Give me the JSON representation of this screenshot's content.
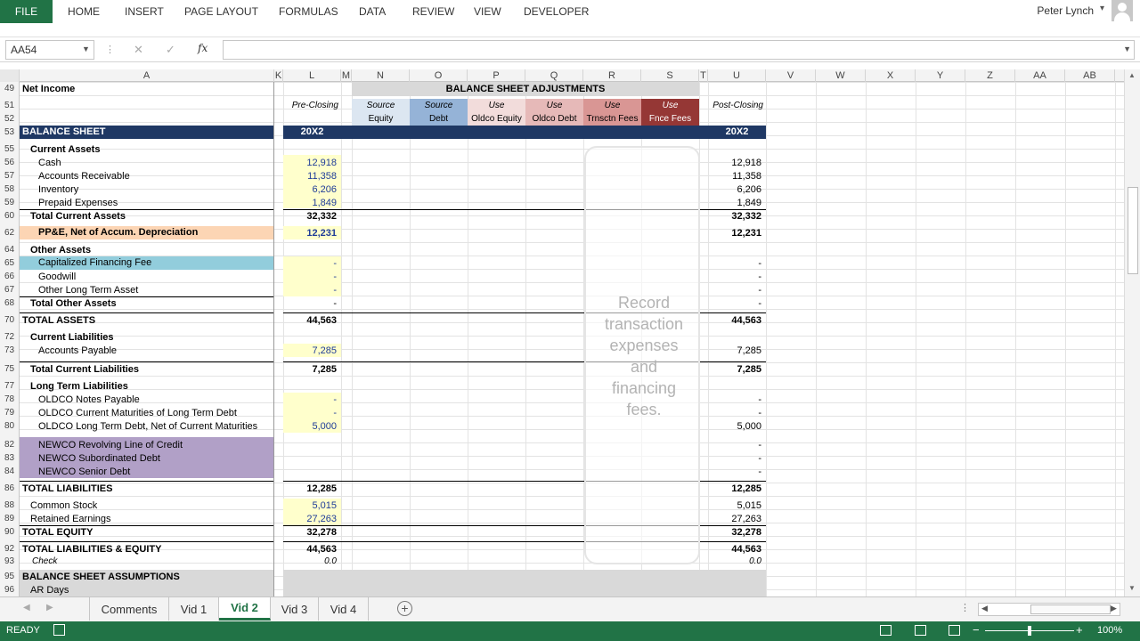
{
  "ribbon": {
    "file": "FILE",
    "tabs": [
      "HOME",
      "INSERT",
      "PAGE LAYOUT",
      "FORMULAS",
      "DATA",
      "REVIEW",
      "VIEW",
      "DEVELOPER"
    ],
    "user": "Peter Lynch"
  },
  "formula_bar": {
    "name_box": "AA54",
    "cancel": "✕",
    "enter": "✓",
    "fx": "fx",
    "formula": ""
  },
  "columns": [
    "A",
    "K",
    "L",
    "M",
    "N",
    "O",
    "P",
    "Q",
    "R",
    "S",
    "T",
    "U",
    "V",
    "W",
    "X",
    "Y",
    "Z",
    "AA",
    "AB"
  ],
  "rows": [
    "49",
    "51",
    "52",
    "53",
    "55",
    "56",
    "57",
    "58",
    "59",
    "60",
    "62",
    "64",
    "65",
    "66",
    "67",
    "68",
    "70",
    "72",
    "73",
    "75",
    "77",
    "78",
    "79",
    "80",
    "82",
    "83",
    "84",
    "86",
    "88",
    "89",
    "90",
    "92",
    "93",
    "95",
    "96"
  ],
  "labels": {
    "net_income": "Net Income",
    "balance_sheet": "BALANCE SHEET",
    "current_assets": "Current Assets",
    "cash": "Cash",
    "ar": "Accounts Receivable",
    "inventory": "Inventory",
    "prepaid": "Prepaid Expenses",
    "total_current_assets": "Total Current Assets",
    "ppe": "PP&E, Net of Accum. Depreciation",
    "other_assets": "Other Assets",
    "cap_fin_fee": "Capitalized Financing Fee",
    "goodwill": "Goodwill",
    "other_lt_asset": "Other Long Term Asset",
    "total_other_assets": "Total Other Assets",
    "total_assets": "TOTAL ASSETS",
    "current_liabilities": "Current Liabilities",
    "ap": "Accounts Payable",
    "total_current_liabilities": "Total Current Liabilities",
    "lt_liabilities": "Long Term Liabilities",
    "oldco_notes": "OLDCO Notes Payable",
    "oldco_curr_mat": "OLDCO Current Maturities of Long Term Debt",
    "oldco_ltd": "OLDCO Long Term Debt, Net of Current Maturities",
    "newco_revolver": "NEWCO Revolving Line of Credit",
    "newco_sub": "NEWCO Subordinated Debt",
    "newco_senior": "NEWCO Senior Debt",
    "total_liabilities": "TOTAL LIABILITIES",
    "common_stock": "Common Stock",
    "retained_earnings": "Retained Earnings",
    "total_equity": "TOTAL EQUITY",
    "total_le": "TOTAL LIABILITIES & EQUITY",
    "check": "Check",
    "bs_assumptions": "BALANCE SHEET ASSUMPTIONS",
    "ar_days": "AR Days"
  },
  "headers": {
    "pre_closing": "Pre-Closing",
    "post_closing": "Post-Closing",
    "adjustments": "BALANCE SHEET ADJUSTMENTS",
    "year": "20X2",
    "adj_cols": [
      {
        "top": "Source",
        "bottom": "Equity",
        "color": "#dce6f1"
      },
      {
        "top": "Source",
        "bottom": "Debt",
        "color": "#95b3d7"
      },
      {
        "top": "Use",
        "bottom": "Oldco Equity",
        "color": "#f2dcdb"
      },
      {
        "top": "Use",
        "bottom": "Oldco Debt",
        "color": "#e6b9b8"
      },
      {
        "top": "Use",
        "bottom": "Trnsctn Fees",
        "color": "#d99694"
      },
      {
        "top": "Use",
        "bottom": "Fnce Fees",
        "color": "#953735"
      }
    ]
  },
  "values": {
    "cash": "12,918",
    "ar": "11,358",
    "inventory": "6,206",
    "prepaid": "1,849",
    "tca": "32,332",
    "ppe": "12,231",
    "dash": "-",
    "total_assets": "44,563",
    "ap": "7,285",
    "tcl": "7,285",
    "oldco_ltd": "5,000",
    "tl": "12,285",
    "cs": "5,015",
    "re": "27,263",
    "te": "32,278",
    "tle": "44,563",
    "check": "0.0"
  },
  "textbox": "Record\ntransaction\nexpenses\nand\nfinancing\nfees.",
  "sheet_tabs": [
    "Comments",
    "Vid 1",
    "Vid 2",
    "Vid 3",
    "Vid 4"
  ],
  "active_tab": "Vid 2",
  "status": {
    "ready": "READY",
    "zoom": "100%"
  },
  "colors": {
    "excel_green": "#217346",
    "navy": "#1f3864",
    "input_yellow": "#ffffcc",
    "ppe_orange": "#fcd5b4",
    "cap_fee_teal": "#92cddc",
    "newco_purple": "#b1a0c7"
  }
}
